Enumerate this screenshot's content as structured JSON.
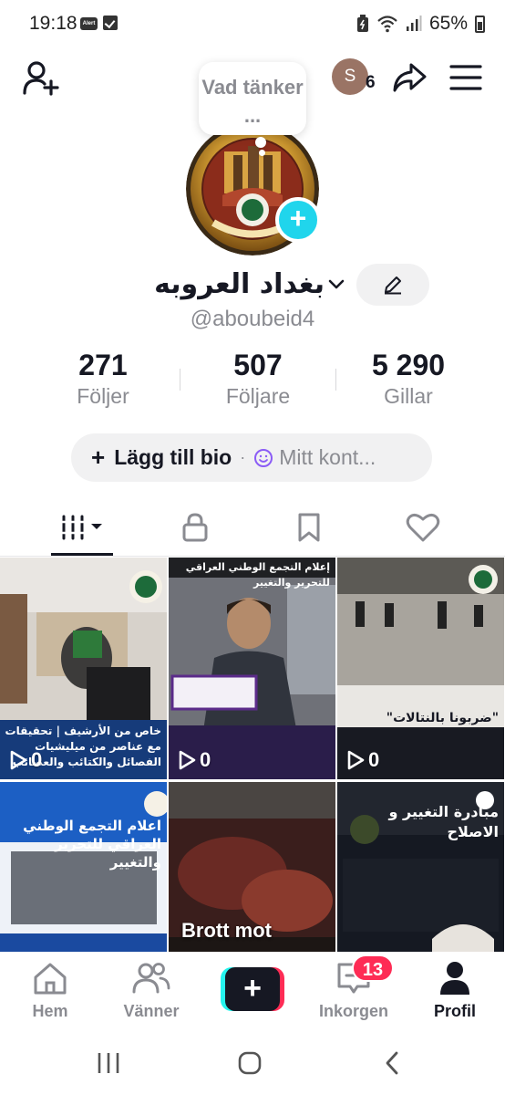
{
  "status_bar": {
    "time": "19:18",
    "battery": "65%",
    "notification_badge": "Alert"
  },
  "header": {
    "story_avatar_initial": "S",
    "story_count": "6",
    "thought_bubble": "Vad tänker ..."
  },
  "profile": {
    "display_name": "بغداد العروبه",
    "username": "@aboubeid4"
  },
  "stats": [
    {
      "value": "271",
      "label": "Följer"
    },
    {
      "value": "507",
      "label": "Följare"
    },
    {
      "value": "5 290",
      "label": "Gillar"
    }
  ],
  "bio": {
    "add_label": "Lägg till bio",
    "my_content_label": "Mitt kont..."
  },
  "tabs": [
    {
      "name": "videos",
      "icon": "grid-icon",
      "active": true
    },
    {
      "name": "private",
      "icon": "lock-icon",
      "active": false
    },
    {
      "name": "favorites",
      "icon": "bookmark-icon",
      "active": false
    },
    {
      "name": "liked",
      "icon": "heart-icon",
      "active": false
    }
  ],
  "videos": [
    {
      "views": "0",
      "caption": "خاص من الأرشيف | تحقيقات مع عناصر من ميليشيات الفصائل والكتائب والعصائب"
    },
    {
      "views": "0",
      "caption": "إعلام التجمع الوطني العراقي للتحرير والتغيير"
    },
    {
      "views": "0",
      "caption": "\"ضربونا بالنتالات\""
    },
    {
      "views": "",
      "caption": "اعلام التجمع الوطني العراقي للتحرير والتغيير"
    },
    {
      "views": "",
      "caption": "Brott mot"
    },
    {
      "views": "",
      "caption": "مبادرة التغيير و الاصلاح"
    }
  ],
  "bottom_nav": [
    {
      "label": "Hem",
      "icon": "home-icon"
    },
    {
      "label": "Vänner",
      "icon": "friends-icon"
    },
    {
      "label": "",
      "icon": "plus-icon"
    },
    {
      "label": "Inkorgen",
      "icon": "inbox-icon",
      "badge": "13"
    },
    {
      "label": "Profil",
      "icon": "profile-icon",
      "active": true
    }
  ],
  "colors": {
    "accent_cyan": "#25f4ee",
    "accent_red": "#fe2c55",
    "add_photo": "#20d5ec",
    "text_primary": "#161823",
    "text_secondary": "#8a8b91"
  }
}
